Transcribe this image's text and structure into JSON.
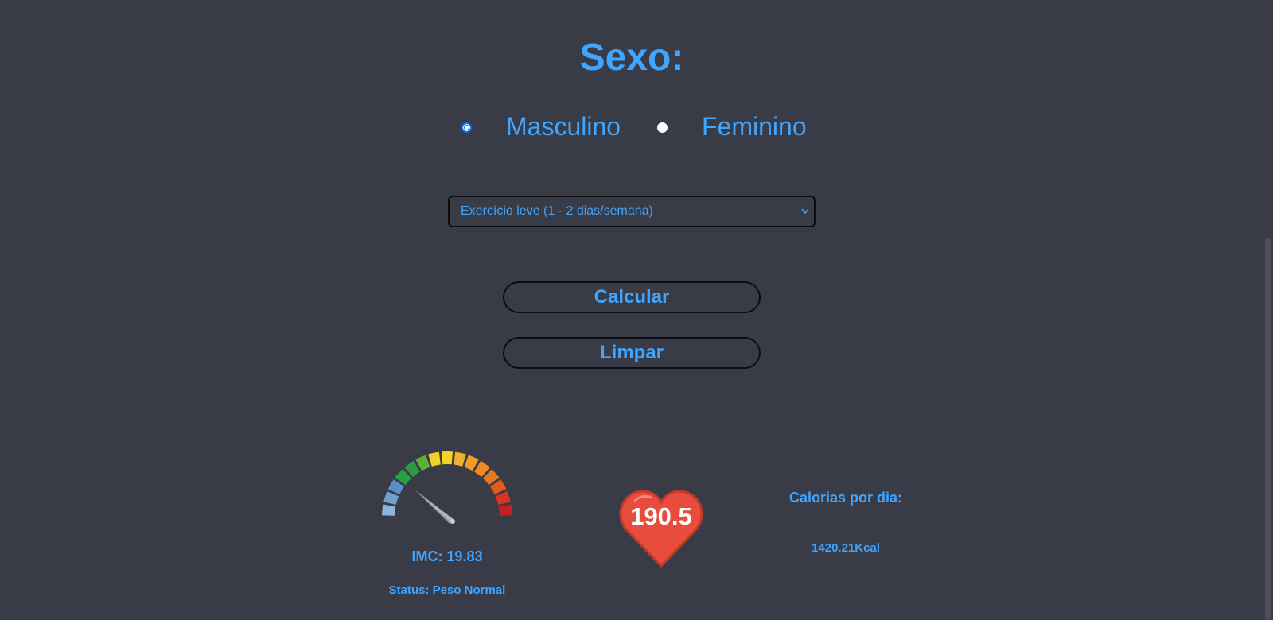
{
  "gender": {
    "title": "Sexo:",
    "options": [
      {
        "label": "Masculino",
        "selected": true
      },
      {
        "label": "Feminino",
        "selected": false
      }
    ]
  },
  "activity": {
    "selected": "Exercício leve (1 - 2 dias/semana)"
  },
  "buttons": {
    "calculate": "Calcular",
    "clear": "Limpar"
  },
  "results": {
    "imc_label": "IMC: 19.83",
    "status_label": "Status: Peso Normal",
    "heart_value": "190.5",
    "calories_title": "Calorias por dia:",
    "calories_value": "1420.21Kcal"
  },
  "colors": {
    "background": "#393b46",
    "accent": "#3fa5ff",
    "heart": "#e74c3c"
  }
}
